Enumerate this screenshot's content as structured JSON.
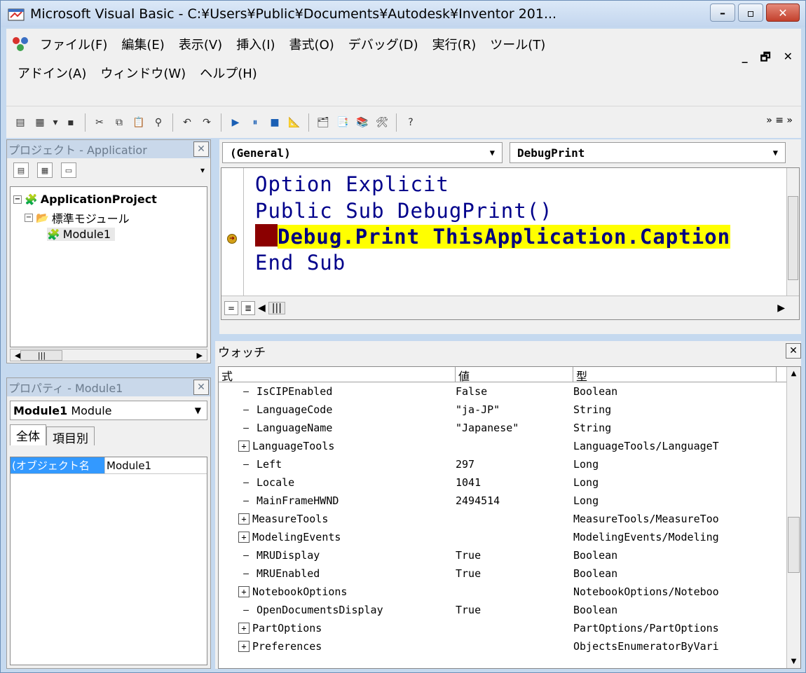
{
  "window": {
    "title": "Microsoft Visual Basic - C:¥Users¥Public¥Documents¥Autodesk¥Inventor 201...",
    "min_label": "–",
    "max_label": "▫",
    "close_label": "✕"
  },
  "menu": {
    "row1": [
      "ファイル(F)",
      "編集(E)",
      "表示(V)",
      "挿入(I)",
      "書式(O)",
      "デバッグ(D)",
      "実行(R)",
      "ツール(T)"
    ],
    "row2": [
      "アドイン(A)",
      "ウィンドウ(W)",
      "ヘルプ(H)"
    ]
  },
  "project": {
    "title": "プロジェクト - Applicatior",
    "root": "ApplicationProject",
    "folder": "標準モジュール",
    "module": "Module1"
  },
  "properties": {
    "title": "プロパティ - Module1",
    "object_name": "Module1",
    "object_type": "Module",
    "tab_all": "全体",
    "tab_category": "項目別",
    "prop_name": "(オブジェクト名",
    "prop_value": "Module1"
  },
  "code": {
    "object_combo": "(General)",
    "proc_combo": "DebugPrint",
    "lines": {
      "l1": "Option Explicit",
      "l2": "Public Sub DebugPrint()",
      "l3": "Debug.Print ThisApplication.Caption",
      "l4": "End Sub"
    }
  },
  "watch": {
    "title": "ウォッチ",
    "col_expr": "式",
    "col_value": "値",
    "col_type": "型",
    "rows": [
      {
        "expr": "IsCIPEnabled",
        "value": "False",
        "type": "Boolean",
        "expandable": false
      },
      {
        "expr": "LanguageCode",
        "value": "\"ja-JP\"",
        "type": "String",
        "expandable": false
      },
      {
        "expr": "LanguageName",
        "value": "\"Japanese\"",
        "type": "String",
        "expandable": false
      },
      {
        "expr": "LanguageTools",
        "value": "",
        "type": "LanguageTools/LanguageT",
        "expandable": true
      },
      {
        "expr": "Left",
        "value": "297",
        "type": "Long",
        "expandable": false
      },
      {
        "expr": "Locale",
        "value": "1041",
        "type": "Long",
        "expandable": false
      },
      {
        "expr": "MainFrameHWND",
        "value": "2494514",
        "type": "Long",
        "expandable": false
      },
      {
        "expr": "MeasureTools",
        "value": "",
        "type": "MeasureTools/MeasureToo",
        "expandable": true
      },
      {
        "expr": "ModelingEvents",
        "value": "",
        "type": "ModelingEvents/Modeling",
        "expandable": true
      },
      {
        "expr": "MRUDisplay",
        "value": "True",
        "type": "Boolean",
        "expandable": false
      },
      {
        "expr": "MRUEnabled",
        "value": "True",
        "type": "Boolean",
        "expandable": false
      },
      {
        "expr": "NotebookOptions",
        "value": "",
        "type": "NotebookOptions/Noteboo",
        "expandable": true
      },
      {
        "expr": "OpenDocumentsDisplay",
        "value": "True",
        "type": "Boolean",
        "expandable": false
      },
      {
        "expr": "PartOptions",
        "value": "",
        "type": "PartOptions/PartOptions",
        "expandable": true
      },
      {
        "expr": "Preferences",
        "value": "",
        "type": "ObjectsEnumeratorByVari",
        "expandable": true
      }
    ]
  }
}
